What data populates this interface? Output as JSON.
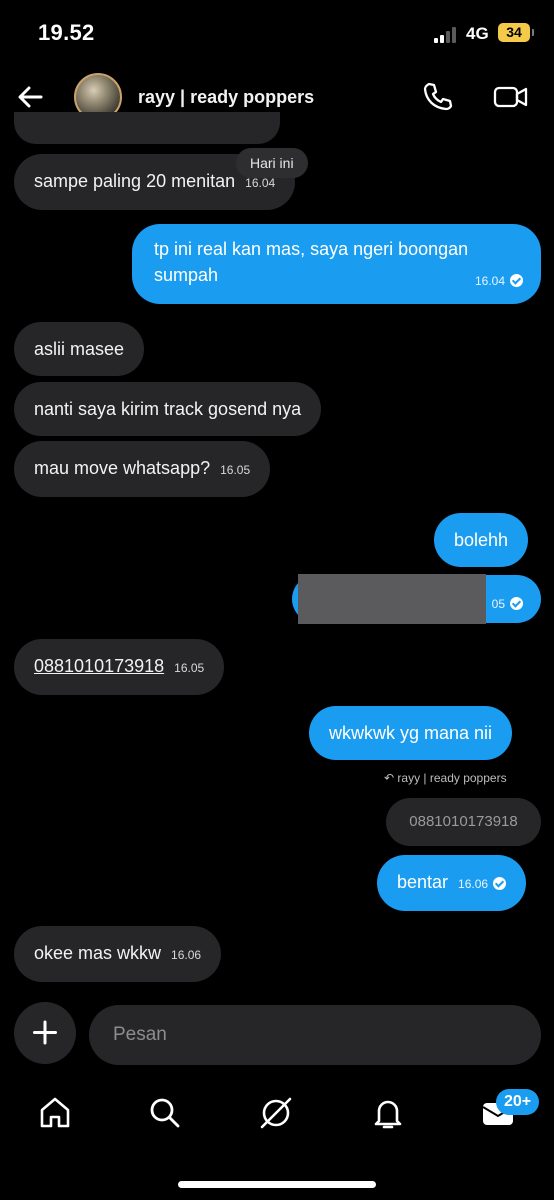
{
  "status_bar": {
    "time": "19.52",
    "network": "4G",
    "battery": "34"
  },
  "header": {
    "contact_name": "rayy | ready poppers"
  },
  "date_chip": "Hari ini",
  "messages": [
    {
      "dir": "in",
      "text": "sampe paling 20 menitan",
      "time": "16.04"
    },
    {
      "dir": "out",
      "text": "tp ini real kan mas, saya ngeri boongan sumpah",
      "time": "16.04"
    },
    {
      "dir": "in",
      "text": "aslii masee"
    },
    {
      "dir": "in",
      "text": "nanti saya kirim track gosend nya"
    },
    {
      "dir": "in",
      "text": "mau move whatsapp?",
      "time": "16.05"
    },
    {
      "dir": "out",
      "text": "bolehh"
    },
    {
      "dir": "out",
      "text": "",
      "time": "05"
    },
    {
      "dir": "in",
      "text": "0881010173918",
      "time": "16.05"
    },
    {
      "dir": "out",
      "text": "wkwkwk yg mana nii"
    },
    {
      "dir": "out",
      "text": "bentar",
      "time": "16.06"
    },
    {
      "dir": "in",
      "text": "okee mas wkkw",
      "time": "16.06"
    }
  ],
  "reply": {
    "label": "rayy | ready poppers",
    "quote": "0881010173918"
  },
  "composer": {
    "placeholder": "Pesan"
  },
  "nav": {
    "badge": "20+"
  }
}
